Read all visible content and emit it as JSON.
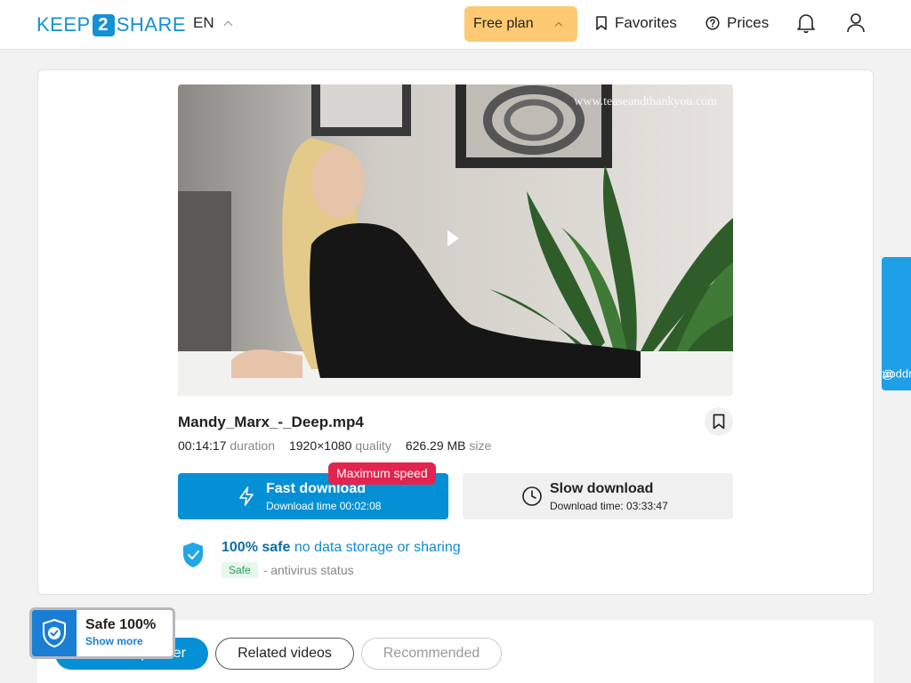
{
  "header": {
    "logo_left": "KEEP",
    "logo_mid": "2",
    "logo_right": "SHARE",
    "language": "EN",
    "plan_label": "Free plan",
    "favorites_label": "Favorites",
    "prices_label": "Prices"
  },
  "video": {
    "watermark": "www.teaseandthankyou.com"
  },
  "file": {
    "name": "Mandy_Marx_-_Deep.mp4",
    "duration_value": "00:14:17",
    "duration_label": "duration",
    "quality_value": "1920×1080",
    "quality_label": "quality",
    "size_value": "626.29 MB",
    "size_label": "size"
  },
  "download": {
    "badge": "Maximum speed",
    "fast_title": "Fast download",
    "fast_sub": "Download time 00:02:08",
    "slow_title": "Slow download",
    "slow_sub": "Download time: 03:33:47"
  },
  "safety": {
    "strong": "100% safe",
    "link": "no data storage or sharing",
    "av_badge": "Safe",
    "av_text": "- antivirus status"
  },
  "support": {
    "label": "contact support"
  },
  "tabs": [
    {
      "label": "From this partner",
      "active": true
    },
    {
      "label": "Related videos",
      "active": false
    },
    {
      "label": "Recommended",
      "active": false
    }
  ],
  "safe_widget": {
    "title": "Safe 100%",
    "link": "Show more"
  },
  "colors": {
    "brand": "#1591d3",
    "plan": "#fdca73",
    "primary": "#0590d6",
    "badge": "#e2244e",
    "support": "#1fa0e6"
  },
  "icons": [
    "bookmark-icon",
    "help-circle-icon",
    "bell-icon",
    "user-icon",
    "bolt-icon",
    "clock-icon",
    "shield-check-icon",
    "play-icon",
    "at-icon"
  ]
}
